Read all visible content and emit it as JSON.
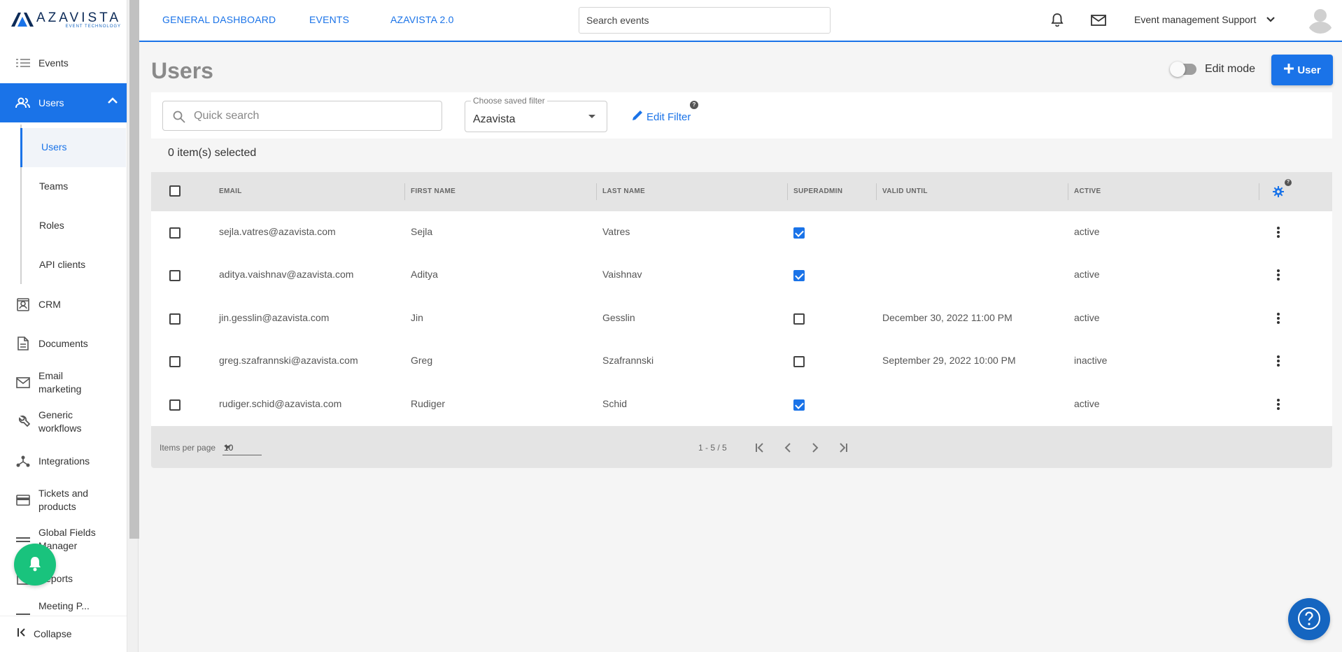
{
  "brand": {
    "name": "AZAVISTA",
    "tagline": "EVENT TECHNOLOGY"
  },
  "sidebar": {
    "items": [
      {
        "label": "Events",
        "icon": "events-list-icon"
      },
      {
        "label": "Users",
        "icon": "people-icon",
        "active": true,
        "expanded": true
      },
      {
        "label": "CRM",
        "icon": "contact-card-icon"
      },
      {
        "label": "Documents",
        "icon": "document-icon"
      },
      {
        "label": "Email marketing",
        "icon": "mail-icon"
      },
      {
        "label": "Generic workflows",
        "icon": "wrench-icon"
      },
      {
        "label": "Integrations",
        "icon": "integrations-icon"
      },
      {
        "label": "Tickets and products",
        "icon": "card-icon"
      },
      {
        "label": "Global Fields Manager",
        "icon": "fields-icon"
      },
      {
        "label": "Reports",
        "icon": "reports-icon"
      },
      {
        "label": "Meeting P...",
        "icon": "meeting-icon"
      }
    ],
    "subitems": [
      {
        "label": "Users",
        "active": true
      },
      {
        "label": "Teams"
      },
      {
        "label": "Roles"
      },
      {
        "label": "API clients"
      }
    ],
    "collapse_label": "Collapse"
  },
  "topbar": {
    "links": [
      "GENERAL DASHBOARD",
      "EVENTS",
      "AZAVISTA 2.0"
    ],
    "search_placeholder": "Search events",
    "user_name": "Event management Support"
  },
  "page": {
    "title": "Users",
    "edit_mode_label": "Edit mode",
    "edit_mode_on": false,
    "add_button_label": "User"
  },
  "filters": {
    "quick_search_placeholder": "Quick search",
    "saved_filter_caption": "Choose saved filter",
    "saved_filter_value": "Azavista",
    "edit_filter_label": "Edit Filter",
    "help": "?"
  },
  "selection": {
    "text": "0 item(s) selected"
  },
  "table": {
    "columns": [
      "EMAIL",
      "FIRST NAME",
      "LAST NAME",
      "SUPERADMIN",
      "VALID UNTIL",
      "ACTIVE"
    ],
    "rows": [
      {
        "email": "sejla.vatres@azavista.com",
        "first": "Sejla",
        "last": "Vatres",
        "superadmin": true,
        "valid_until": "",
        "active": "active"
      },
      {
        "email": "aditya.vaishnav@azavista.com",
        "first": "Aditya",
        "last": "Vaishnav",
        "superadmin": true,
        "valid_until": "",
        "active": "active"
      },
      {
        "email": "jin.gesslin@azavista.com",
        "first": "Jin",
        "last": "Gesslin",
        "superadmin": false,
        "valid_until": "December 30, 2022 11:00 PM",
        "active": "active"
      },
      {
        "email": "greg.szafrannski@azavista.com",
        "first": "Greg",
        "last": "Szafrannski",
        "superadmin": false,
        "valid_until": "September 29, 2022 10:00 PM",
        "active": "inactive"
      },
      {
        "email": "rudiger.schid@azavista.com",
        "first": "Rudiger",
        "last": "Schid",
        "superadmin": true,
        "valid_until": "",
        "active": "active"
      }
    ]
  },
  "pagination": {
    "items_per_page_label": "Items per page",
    "items_per_page": "10",
    "range": "1 - 5 / 5"
  },
  "colors": {
    "accent": "#1a73e8",
    "fab_green": "#19c37d",
    "help_blue": "#1565c0"
  }
}
